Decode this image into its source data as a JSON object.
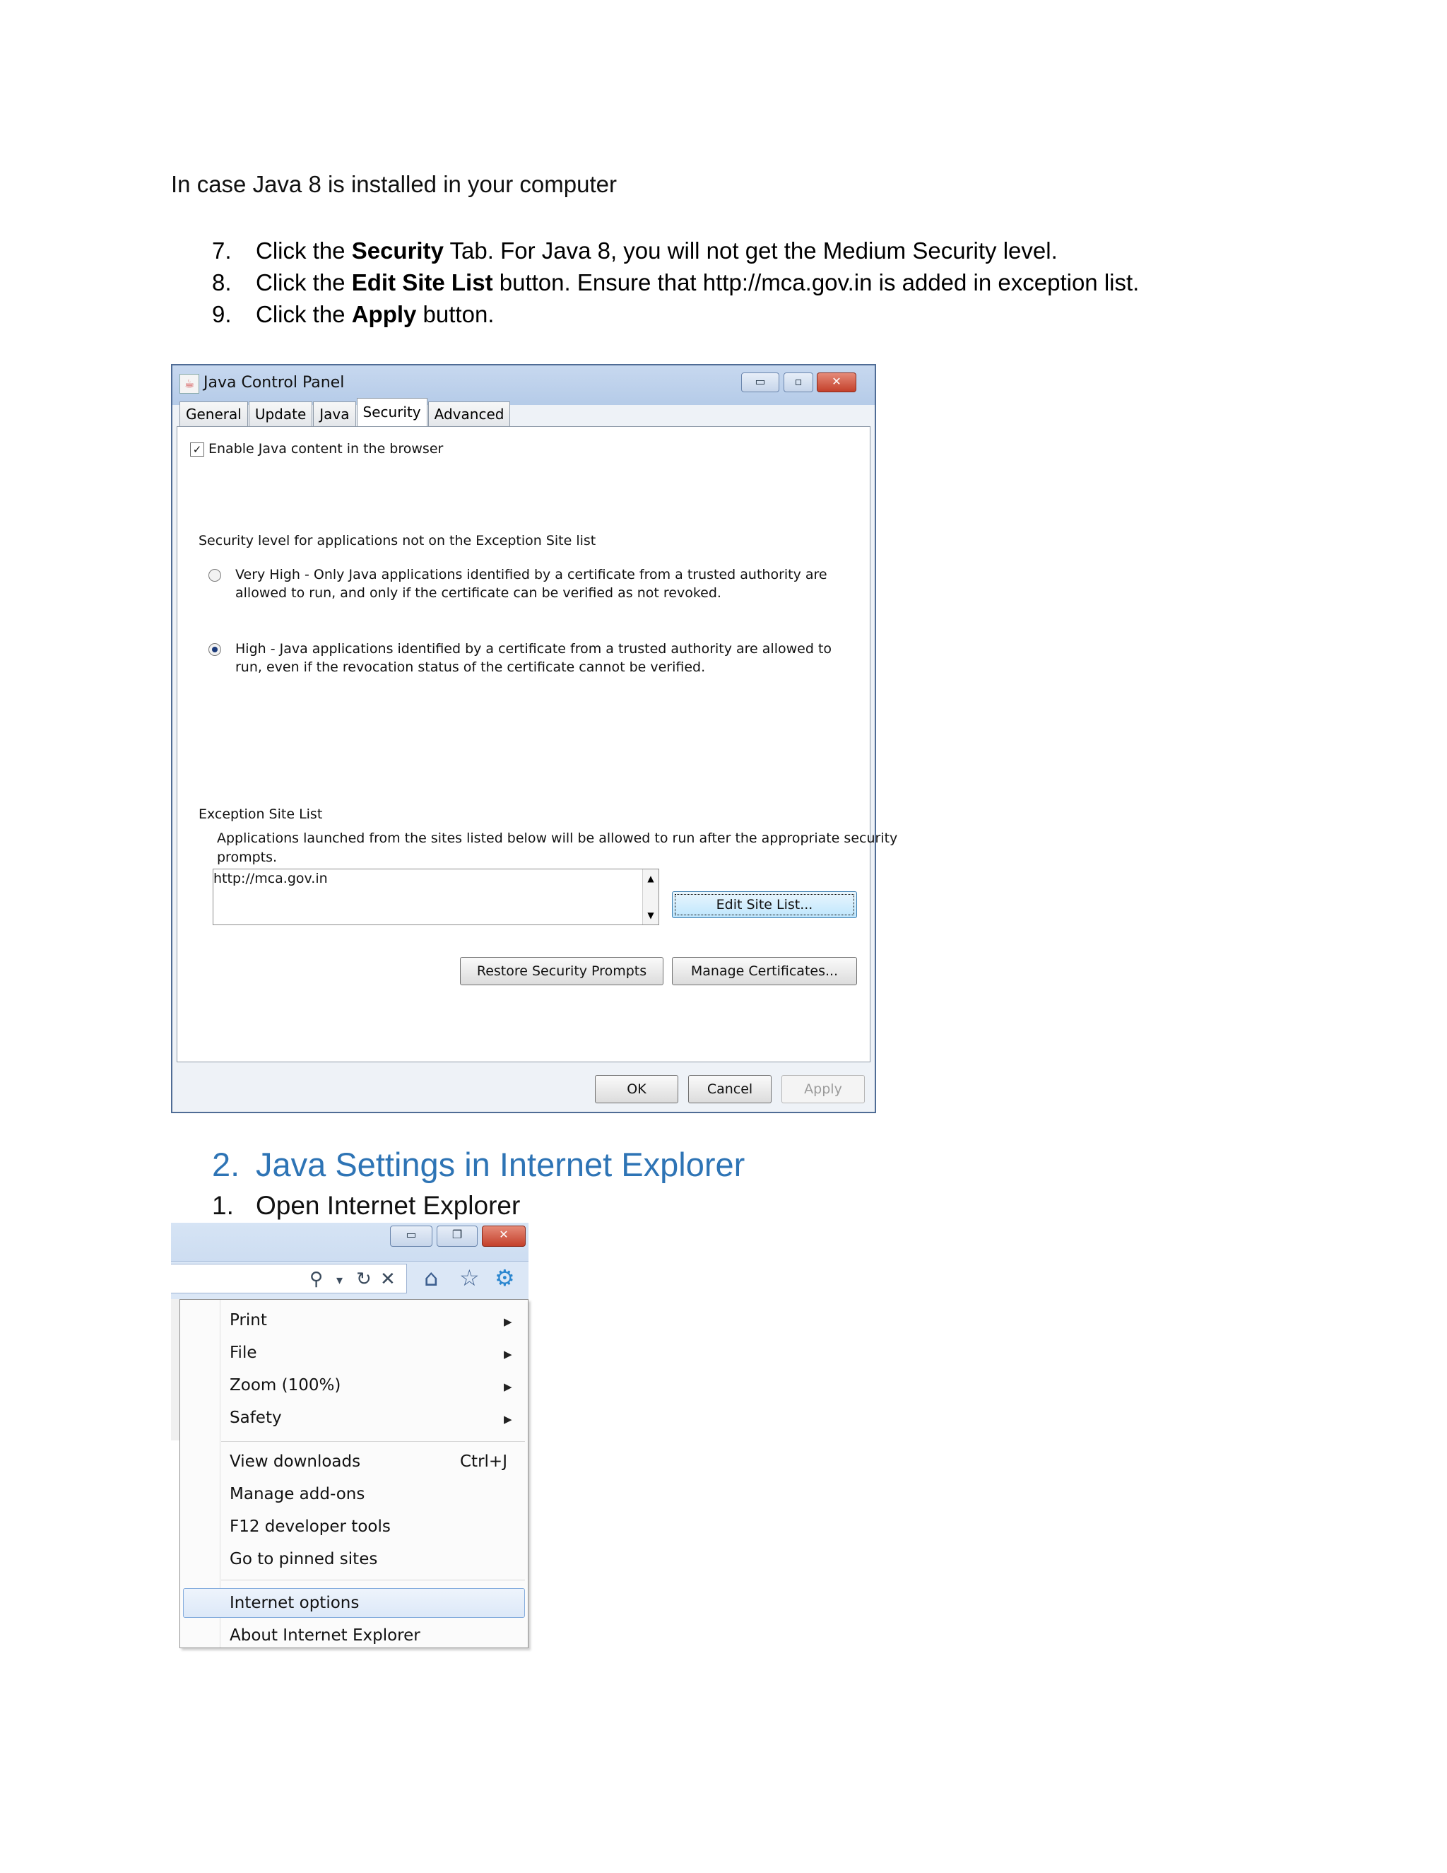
{
  "intro": "In case Java 8 is installed in your computer",
  "steps": [
    {
      "num": "7.",
      "before": "Click the ",
      "bold": "Security",
      "after": " Tab. For Java 8, you will not get the Medium Security level."
    },
    {
      "num": "8.",
      "before": "Click the ",
      "bold": "Edit Site List",
      "after": " button. Ensure that http://mca.gov.in is added in exception list."
    },
    {
      "num": "9.",
      "before": "Click the ",
      "bold": "Apply",
      "after": " button."
    }
  ],
  "java_panel": {
    "title": "Java Control Panel",
    "window_buttons": {
      "minimize": "▭",
      "maximize": "▫",
      "close": "✕"
    },
    "tabs": [
      "General",
      "Update",
      "Java",
      "Security",
      "Advanced"
    ],
    "active_tab": "Security",
    "enable_checkbox": {
      "label": "Enable Java content in the browser",
      "checked": true
    },
    "security_level_label": "Security level for applications not on the Exception Site list",
    "very_high": {
      "line1": "Very High - Only Java applications identified by a certificate from a trusted authority are",
      "line2": "allowed to run, and only if the certificate can be verified as not revoked.",
      "selected": false
    },
    "high": {
      "line1": "High - Java applications identified by a certificate from a trusted authority are allowed to",
      "line2": "run, even if the revocation status of the certificate cannot be verified.",
      "selected": true
    },
    "exception_title": "Exception Site List",
    "exception_desc_line1": "Applications launched from the sites listed below will be allowed to run after the appropriate security",
    "exception_desc_line2": "prompts.",
    "exception_entry": "http://mca.gov.in",
    "edit_site_list": "Edit Site List...",
    "restore_prompts": "Restore Security Prompts",
    "manage_certs": "Manage Certificates...",
    "ok": "OK",
    "cancel": "Cancel",
    "apply": "Apply"
  },
  "section_heading": {
    "num": "2.",
    "text": "Java Settings in Internet Explorer"
  },
  "sub_step": {
    "num": "1.",
    "text": "Open Internet Explorer"
  },
  "ie": {
    "toolbar_icons": {
      "search": "⚲",
      "dropdown": "▾",
      "refresh": "↻",
      "stop": "✕",
      "home": "⌂",
      "favorites": "☆",
      "tools": "⚙"
    },
    "window_buttons": {
      "minimize": "▭",
      "restore": "❐",
      "close": "✕"
    },
    "menu_group1": [
      "Print",
      "File",
      "Zoom (100%)",
      "Safety"
    ],
    "menu_group2": [
      "View downloads",
      "Manage add-ons",
      "F12 developer tools",
      "Go to pinned sites"
    ],
    "view_downloads_shortcut": "Ctrl+J",
    "menu_group3": [
      "Internet options",
      "About Internet Explorer"
    ],
    "highlighted_item": "Internet options",
    "submenu_arrow": "▶"
  }
}
